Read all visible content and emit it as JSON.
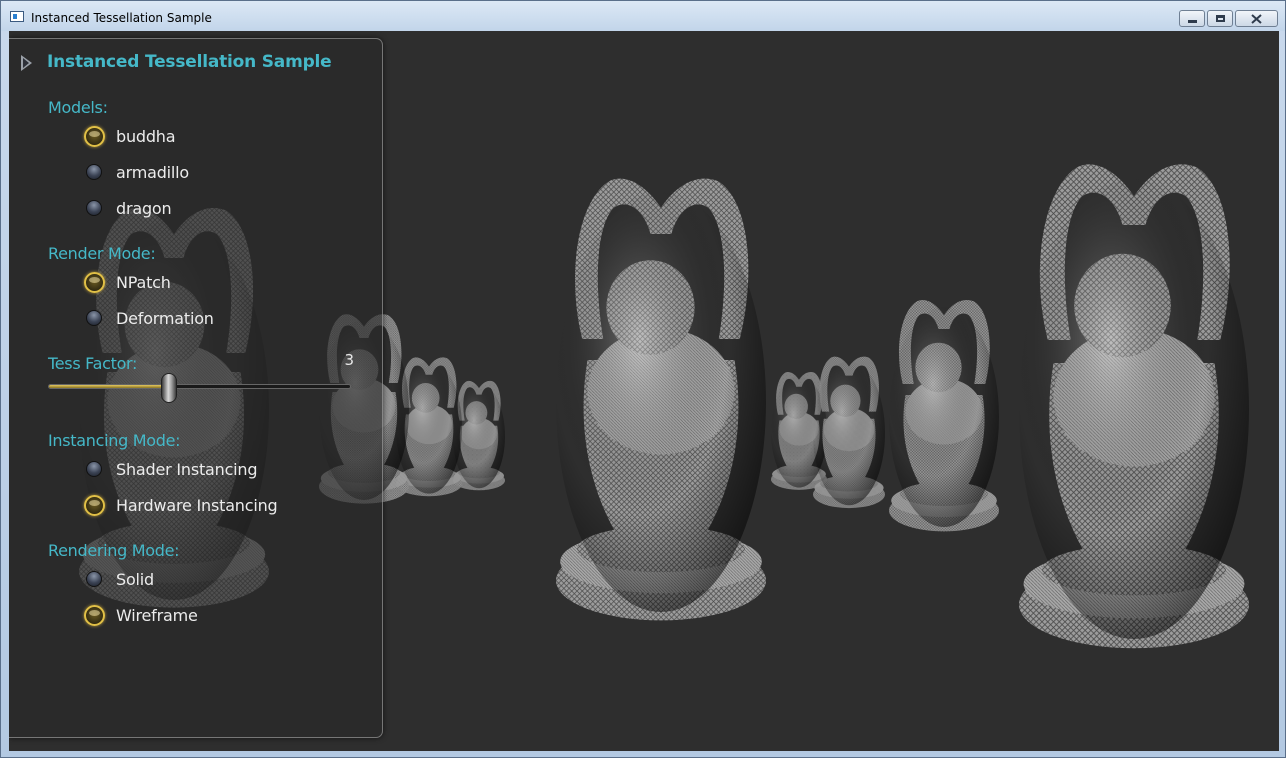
{
  "window": {
    "title": "Instanced Tessellation Sample"
  },
  "panel": {
    "title": "Instanced Tessellation Sample",
    "models": {
      "label": "Models:",
      "options": [
        {
          "label": "buddha",
          "selected": true
        },
        {
          "label": "armadillo",
          "selected": false
        },
        {
          "label": "dragon",
          "selected": false
        }
      ]
    },
    "render_mode": {
      "label": "Render Mode:",
      "options": [
        {
          "label": "NPatch",
          "selected": true
        },
        {
          "label": "Deformation",
          "selected": false
        }
      ]
    },
    "tess_factor": {
      "label": "Tess Factor:",
      "value": "3",
      "slider_fraction": 0.4
    },
    "instancing_mode": {
      "label": "Instancing Mode:",
      "options": [
        {
          "label": "Shader Instancing",
          "selected": false
        },
        {
          "label": "Hardware Instancing",
          "selected": true
        }
      ]
    },
    "rendering_mode": {
      "label": "Rendering Mode:",
      "options": [
        {
          "label": "Solid",
          "selected": false
        },
        {
          "label": "Wireframe",
          "selected": true
        }
      ]
    }
  },
  "colors": {
    "accent_label": "#45b8c8",
    "viewport_background": "#2e2e2e",
    "radio_selected_ring": "#e1c046"
  }
}
